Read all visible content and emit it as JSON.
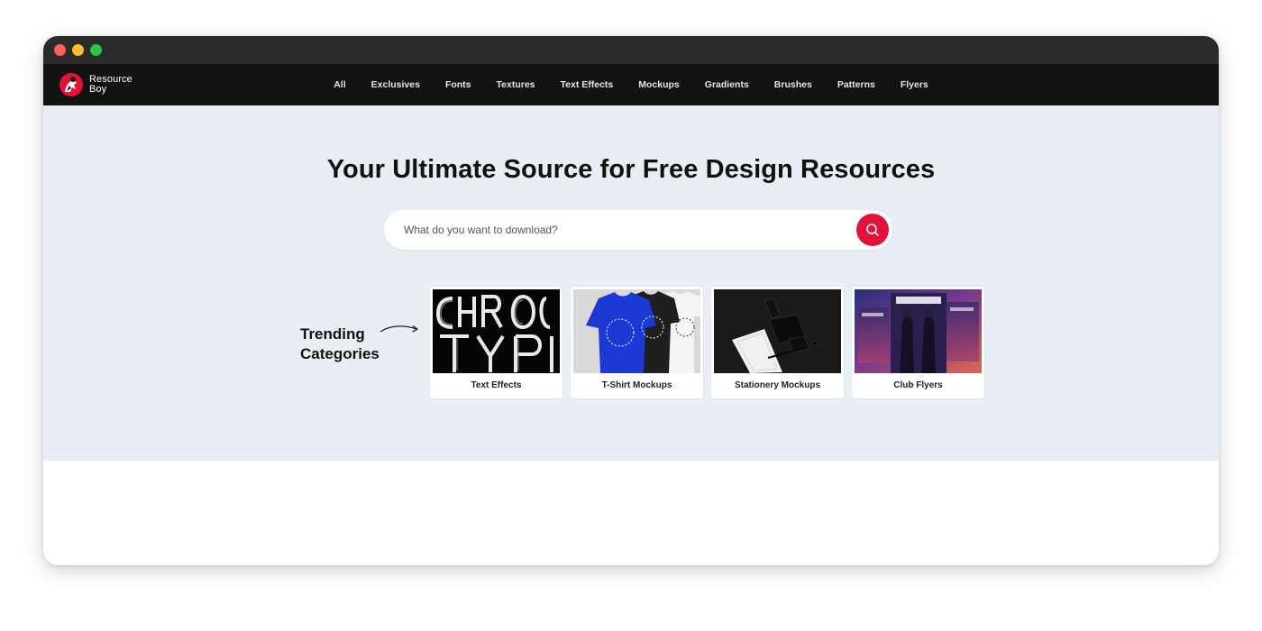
{
  "brand": {
    "name_line1": "Resource",
    "name_line2": "Boy",
    "logo_icon": "resource-boy-logo",
    "accent_color": "#e2123a"
  },
  "nav": {
    "items": [
      {
        "label": "All"
      },
      {
        "label": "Exclusives"
      },
      {
        "label": "Fonts"
      },
      {
        "label": "Textures"
      },
      {
        "label": "Text Effects"
      },
      {
        "label": "Mockups"
      },
      {
        "label": "Gradients"
      },
      {
        "label": "Brushes"
      },
      {
        "label": "Patterns"
      },
      {
        "label": "Flyers"
      }
    ]
  },
  "hero": {
    "headline": "Your Ultimate Source for Free Design Resources",
    "background_color": "#e9eef4"
  },
  "search": {
    "placeholder": "What do you want to download?",
    "value": "",
    "button_icon": "search-icon"
  },
  "trending": {
    "line1": "Trending",
    "line2": "Categories",
    "arrow_icon": "curved-arrow-icon",
    "categories": [
      {
        "label": "Text Effects"
      },
      {
        "label": "T-Shirt Mockups"
      },
      {
        "label": "Stationery Mockups"
      },
      {
        "label": "Club Flyers"
      }
    ]
  },
  "window": {
    "controls": [
      "close",
      "minimize",
      "maximize"
    ]
  }
}
